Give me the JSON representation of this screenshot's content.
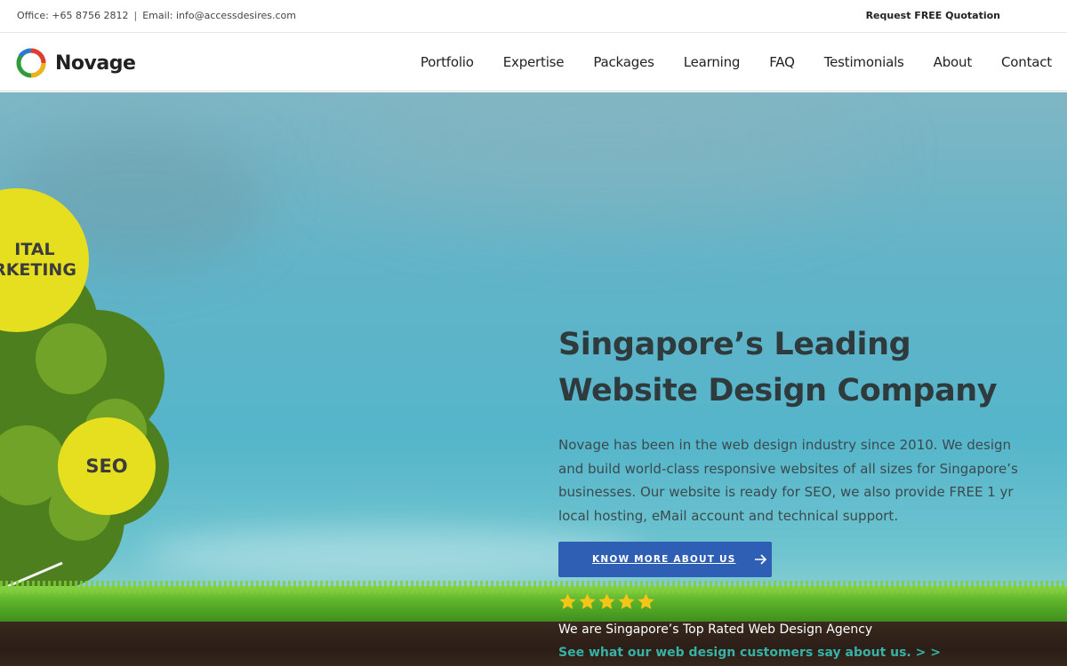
{
  "topbar": {
    "office": "Office: +65 8756 2812",
    "separator": "|",
    "email": "Email: info@accessdesires.com",
    "quote_link": "Request FREE Quotation"
  },
  "header": {
    "logo_text": "Novage",
    "nav": [
      "Portfolio",
      "Expertise",
      "Packages",
      "Learning",
      "FAQ",
      "Testimonials",
      "About",
      "Contact"
    ]
  },
  "hero": {
    "bubble_1_line_1": "ITAL",
    "bubble_1_line_2": "RKETING",
    "bubble_2": "SEO",
    "headline_line_1": "Singapore’s Leading",
    "headline_line_2": "Website Design Company",
    "description": "Novage has been in the web design industry since 2010. We design and build world-class responsive websites of all sizes for Singapore’s businesses. Our website is ready for SEO,  we also provide FREE 1 yr local hosting, eMail account and technical support.",
    "cta_label": "KNOW MORE ABOUT US",
    "rating_stars": 5,
    "tagline": "We are Singapore’s Top Rated Web Design Agency",
    "review_link": "See what our web design customers say about us. > >"
  },
  "colors": {
    "cta_bg": "#2f5fb5",
    "link": "#38b1a6",
    "star": "#f5c518",
    "bubble": "#e6df1f"
  }
}
